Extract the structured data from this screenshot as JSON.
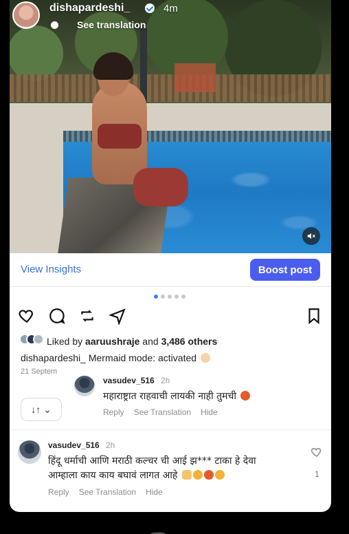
{
  "post": {
    "username": "dishapardeshi_",
    "time": "4m",
    "see_translation": "See translation",
    "insights_label": "View Insights",
    "boost_label": "Boost post",
    "likes_prefix": "Liked by ",
    "likes_user": "aaruushraje",
    "likes_mid": " and ",
    "likes_count": "3,486 others",
    "caption_user": "dishapardeshi_",
    "caption_text": "Mermaid mode: activated",
    "date": "21 Septem",
    "sort_label": "↓↑ ⌄"
  },
  "comments": [
    {
      "user": "vasudev_516",
      "time": "2h",
      "text": "महाराष्ट्रात राहवाची लायकी नाही तुमची",
      "reply": "Reply",
      "see_translation": "See Translation",
      "hide": "Hide"
    },
    {
      "user": "vasudev_516",
      "time": "2h",
      "text_line1": "हिंदू धर्माची आणि मराठी कल्चर ची आई झ*** टाका हे देवा",
      "text_line2": "आम्हाला काय काय बघावं लागत आहे",
      "reply": "Reply",
      "see_translation": "See Translation",
      "hide": "Hide",
      "likes": "1"
    }
  ],
  "carousel": {
    "total": 5,
    "active": 0
  },
  "colors": {
    "link": "#3b6fd8",
    "boost": "#4a5df0",
    "dot_active": "#3b82f6"
  }
}
